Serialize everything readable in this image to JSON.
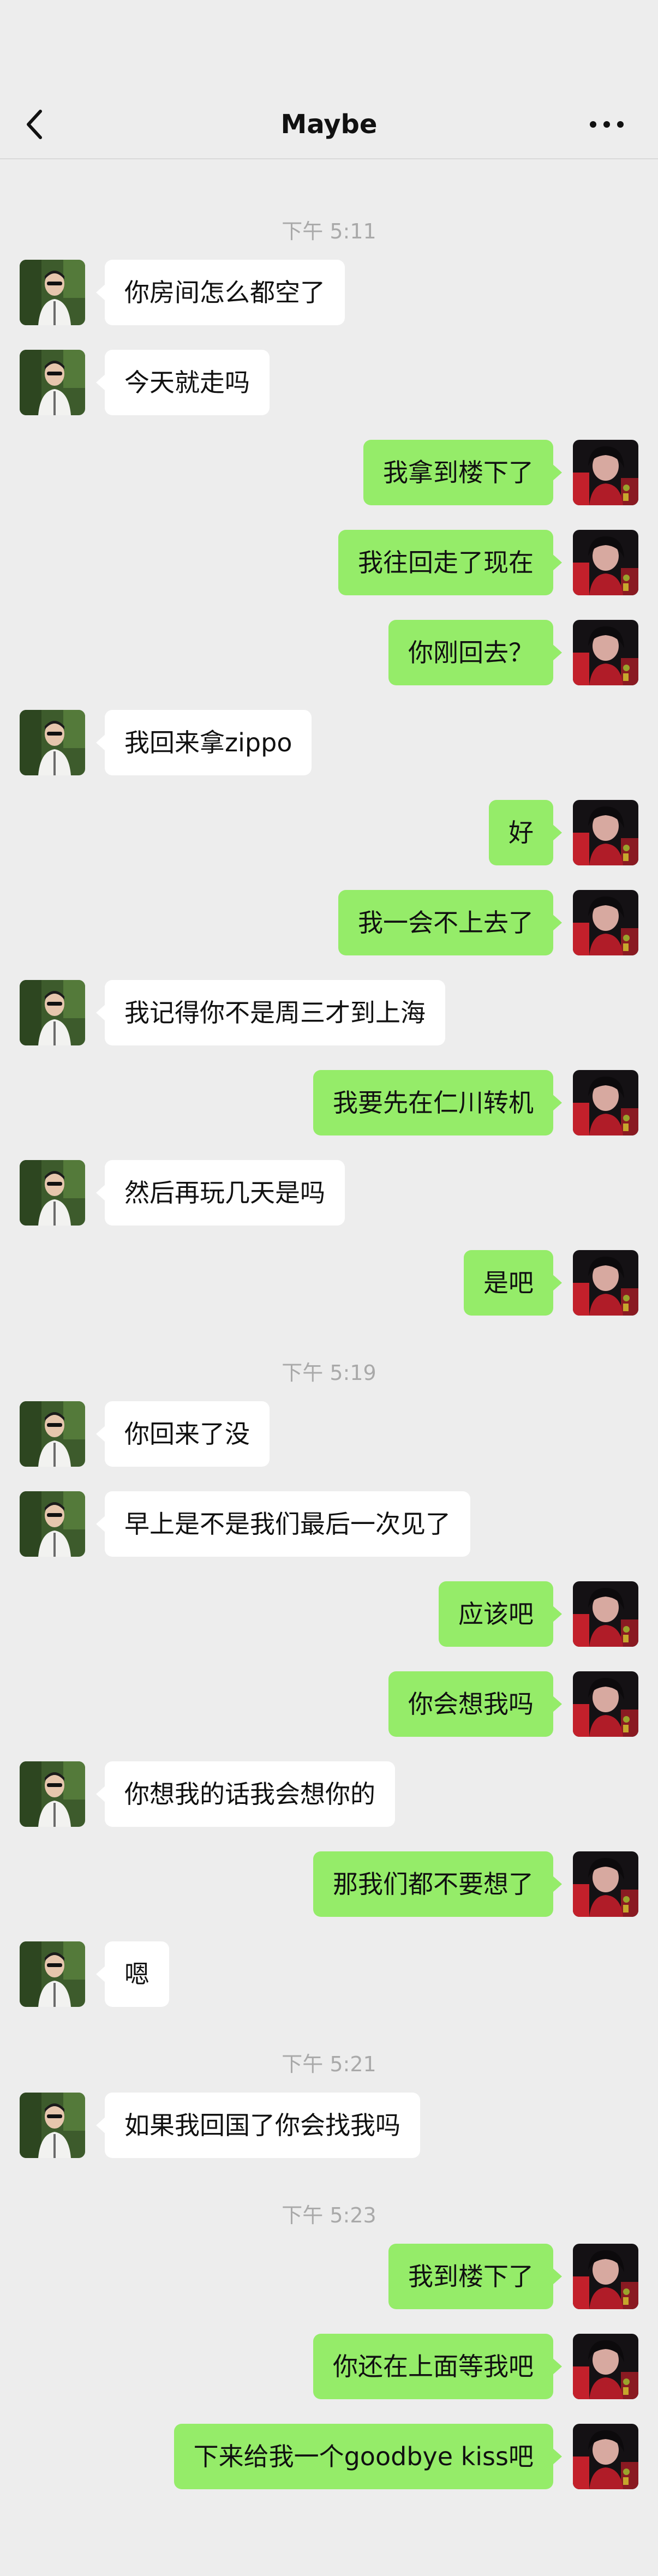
{
  "header": {
    "title": "Maybe"
  },
  "icons": {
    "back": "chevron-left-icon",
    "more": "more-dots-icon",
    "contact_avatar": "contact-avatar",
    "self_avatar": "self-avatar"
  },
  "colors": {
    "background": "#ededed",
    "self_bubble": "#95ec69",
    "other_bubble": "#ffffff",
    "timestamp": "#a9a9a9"
  },
  "messages": [
    {
      "type": "time",
      "text": "下午 5:11"
    },
    {
      "type": "msg",
      "side": "left",
      "text": "你房间怎么都空了"
    },
    {
      "type": "msg",
      "side": "left",
      "text": "今天就走吗"
    },
    {
      "type": "msg",
      "side": "right",
      "text": "我拿到楼下了"
    },
    {
      "type": "msg",
      "side": "right",
      "text": "我往回走了现在"
    },
    {
      "type": "msg",
      "side": "right",
      "text": "你刚回去？"
    },
    {
      "type": "msg",
      "side": "left",
      "text": "我回来拿zippo"
    },
    {
      "type": "msg",
      "side": "right",
      "text": "好"
    },
    {
      "type": "msg",
      "side": "right",
      "text": "我一会不上去了"
    },
    {
      "type": "msg",
      "side": "left",
      "text": "我记得你不是周三才到上海"
    },
    {
      "type": "msg",
      "side": "right",
      "text": "我要先在仁川转机"
    },
    {
      "type": "msg",
      "side": "left",
      "text": "然后再玩几天是吗"
    },
    {
      "type": "msg",
      "side": "right",
      "text": "是吧"
    },
    {
      "type": "time",
      "text": "下午 5:19"
    },
    {
      "type": "msg",
      "side": "left",
      "text": "你回来了没"
    },
    {
      "type": "msg",
      "side": "left",
      "text": "早上是不是我们最后一次见了"
    },
    {
      "type": "msg",
      "side": "right",
      "text": "应该吧"
    },
    {
      "type": "msg",
      "side": "right",
      "text": "你会想我吗"
    },
    {
      "type": "msg",
      "side": "left",
      "text": "你想我的话我会想你的"
    },
    {
      "type": "msg",
      "side": "right",
      "text": "那我们都不要想了"
    },
    {
      "type": "msg",
      "side": "left",
      "text": "嗯"
    },
    {
      "type": "time",
      "text": "下午 5:21"
    },
    {
      "type": "msg",
      "side": "left",
      "text": "如果我回国了你会找我吗"
    },
    {
      "type": "time",
      "text": "下午 5:23"
    },
    {
      "type": "msg",
      "side": "right",
      "text": "我到楼下了"
    },
    {
      "type": "msg",
      "side": "right",
      "text": "你还在上面等我吧"
    },
    {
      "type": "msg",
      "side": "right",
      "text": "下来给我一个goodbye kiss吧"
    }
  ]
}
